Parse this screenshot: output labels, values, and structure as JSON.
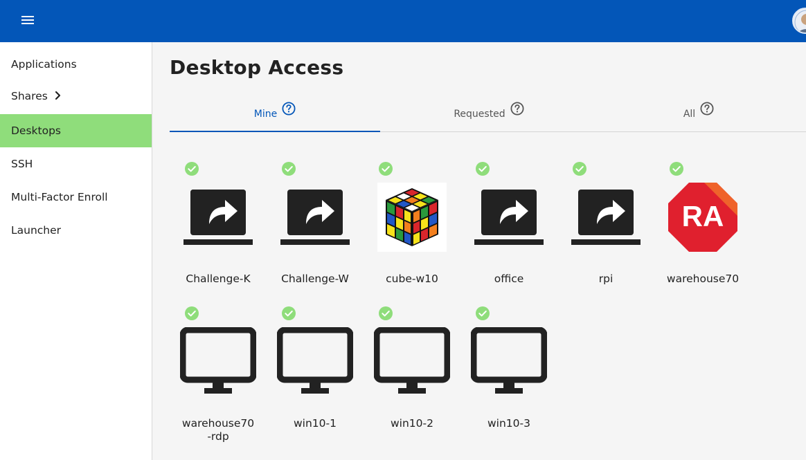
{
  "topbar": {
    "menu_icon": "hamburger-icon",
    "avatar_icon": "user-avatar"
  },
  "sidebar": {
    "items": [
      {
        "label": "Applications",
        "active": false
      },
      {
        "label": "Shares",
        "active": false,
        "icon": "chevron-right-icon"
      },
      {
        "label": "Desktops",
        "active": true
      },
      {
        "label": "SSH",
        "active": false
      },
      {
        "label": "Multi-Factor Enroll",
        "active": false
      },
      {
        "label": "Launcher",
        "active": false
      }
    ]
  },
  "main": {
    "title": "Desktop Access",
    "tabs": [
      {
        "label": "Mine",
        "active": true,
        "icon": "help-circle-icon"
      },
      {
        "label": "Requested",
        "active": false,
        "icon": "help-circle-icon"
      },
      {
        "label": "All",
        "active": false,
        "icon": "help-circle-icon"
      }
    ],
    "desktops": [
      {
        "name": "Challenge-K",
        "icon": "laptop-share-icon",
        "status": "online"
      },
      {
        "name": "Challenge-W",
        "icon": "laptop-share-icon",
        "status": "online"
      },
      {
        "name": "cube-w10",
        "icon": "rubiks-cube-icon",
        "status": "online"
      },
      {
        "name": "office",
        "icon": "laptop-share-icon",
        "status": "online"
      },
      {
        "name": "rpi",
        "icon": "laptop-share-icon",
        "status": "online"
      },
      {
        "name": "warehouse70",
        "icon": "ra-logo-icon",
        "logo_text": "RA",
        "status": "online"
      },
      {
        "name": "warehouse70\n-rdp",
        "icon": "monitor-icon",
        "status": "online"
      },
      {
        "name": "win10-1",
        "icon": "monitor-icon",
        "status": "online"
      },
      {
        "name": "win10-2",
        "icon": "monitor-icon",
        "status": "online"
      },
      {
        "name": "win10-3",
        "icon": "monitor-icon",
        "status": "online"
      }
    ]
  },
  "colors": {
    "topbar": "#0356b8",
    "active_nav": "#8fdd7b",
    "status_online": "#8fdd7b",
    "tab_active": "#0356b8",
    "ra_logo": "#e0202e"
  }
}
